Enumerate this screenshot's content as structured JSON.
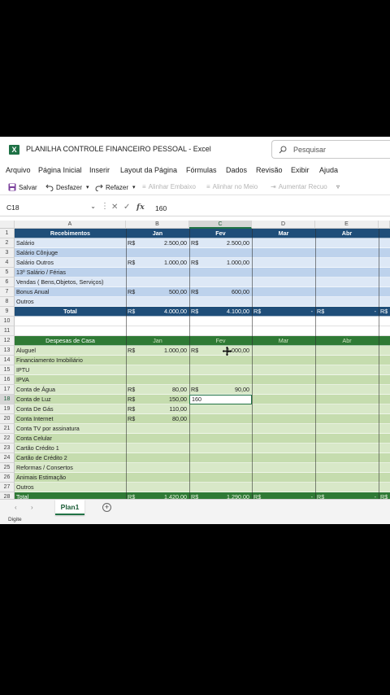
{
  "window": {
    "title": "PLANILHA CONTROLE FINANCEIRO PESSOAL  -  Excel",
    "search_placeholder": "Pesquisar"
  },
  "menu": [
    "Arquivo",
    "Página Inicial",
    "Inserir",
    "Layout da Página",
    "Fórmulas",
    "Dados",
    "Revisão",
    "Exibir",
    "Ajuda"
  ],
  "ribbon": {
    "save": "Salvar",
    "undo": "Desfazer",
    "redo": "Refazer",
    "align_top": "Alinhar Embaixo",
    "align_middle": "Alinhar no Meio",
    "increase_indent": "Aumentar Recuo"
  },
  "formula_bar": {
    "name_box": "C18",
    "value": "160"
  },
  "columns": [
    "A",
    "B",
    "C",
    "D",
    "E"
  ],
  "rows": [
    "1",
    "2",
    "3",
    "4",
    "5",
    "6",
    "7",
    "8",
    "9",
    "10",
    "11",
    "12",
    "13",
    "14",
    "15",
    "16",
    "17",
    "18",
    "19",
    "20",
    "21",
    "22",
    "23",
    "24",
    "25",
    "26",
    "27",
    "28"
  ],
  "currency": "R$",
  "receipts": {
    "header": "Recebimentos",
    "months": [
      "Jan",
      "Fev",
      "Mar",
      "Abr"
    ],
    "items": [
      {
        "label": "Salário",
        "jan": "2.500,00",
        "fev": "2.500,00"
      },
      {
        "label": "Salário Cônjuge",
        "jan": "",
        "fev": ""
      },
      {
        "label": "Salário Outros",
        "jan": "1.000,00",
        "fev": "1.000,00"
      },
      {
        "label": "13º Salário / Férias",
        "jan": "",
        "fev": ""
      },
      {
        "label": "Vendas ( Bens,Objetos, Serviços)",
        "jan": "",
        "fev": ""
      },
      {
        "label": "Bonus Anual",
        "jan": "500,00",
        "fev": "600,00"
      },
      {
        "label": "Outros",
        "jan": "",
        "fev": ""
      }
    ],
    "total_label": "Total",
    "total": {
      "jan": "4.000,00",
      "fev": "4.100,00",
      "mar": "-",
      "abr": "-"
    }
  },
  "expenses": {
    "header": "Despesas de Casa",
    "months": [
      "Jan",
      "Fev",
      "Mar",
      "Abr"
    ],
    "items": [
      {
        "label": "Aluguel",
        "jan": "1.000,00",
        "fev": "1.000,00"
      },
      {
        "label": "Financiamento Imobiliário",
        "jan": "",
        "fev": ""
      },
      {
        "label": "IPTU",
        "jan": "",
        "fev": ""
      },
      {
        "label": "IPVA",
        "jan": "",
        "fev": ""
      },
      {
        "label": "Conta de Água",
        "jan": "80,00",
        "fev": "90,00"
      },
      {
        "label": "Conta de Luz",
        "jan": "150,00",
        "fev": "160"
      },
      {
        "label": "Conta De Gás",
        "jan": "110,00",
        "fev": ""
      },
      {
        "label": "Conta Internet",
        "jan": "80,00",
        "fev": ""
      },
      {
        "label": "Conta TV por assinatura",
        "jan": "",
        "fev": ""
      },
      {
        "label": "Conta Celular",
        "jan": "",
        "fev": ""
      },
      {
        "label": "Cartão Crédito 1",
        "jan": "",
        "fev": ""
      },
      {
        "label": "Cartão de Crédito 2",
        "jan": "",
        "fev": ""
      },
      {
        "label": "Reformas / Consertos",
        "jan": "",
        "fev": ""
      },
      {
        "label": "Animais Estimação",
        "jan": "",
        "fev": ""
      },
      {
        "label": "Outros",
        "jan": "",
        "fev": ""
      }
    ],
    "total_label": "Total",
    "total": {
      "jan": "1.420,00",
      "fev": "1.290,00",
      "mar": "-",
      "abr": "-"
    }
  },
  "sheet_tab": "Plan1",
  "status": "Digite",
  "colors": {
    "blue_header": "#1f4e79",
    "blue_row_light": "#dde8f6",
    "blue_row_mid": "#bdd2ec",
    "green_header": "#2f7a35",
    "green_row_light": "#d8e8c8",
    "green_row_mid": "#c5dcae",
    "excel_green": "#217346"
  }
}
